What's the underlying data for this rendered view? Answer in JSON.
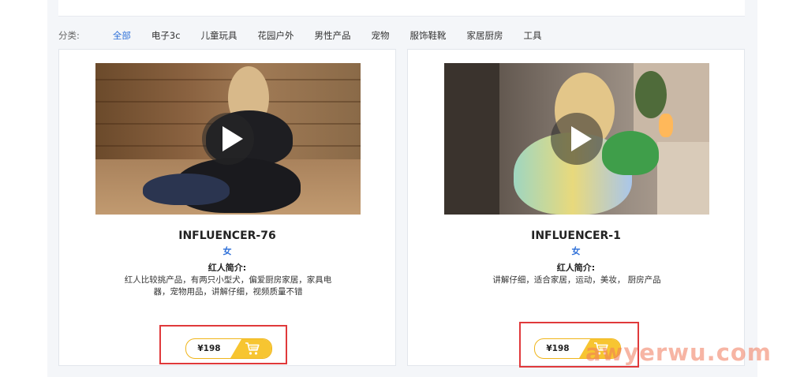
{
  "categories": {
    "label": "分类:",
    "items": [
      "全部",
      "电子3c",
      "儿童玩具",
      "花园户外",
      "男性产品",
      "宠物",
      "服饰鞋靴",
      "家居厨房",
      "工具"
    ],
    "active_index": 0,
    "active_color": "#2d6fd8"
  },
  "cards": [
    {
      "name": "INFLUENCER-76",
      "gender": "女",
      "intro_title": "红人简介:",
      "intro": "红人比较挑产品，有两只小型犬，偏爱厨房家居，家具电器，宠物用品，讲解仔细，视频质量不错",
      "price": "¥198",
      "thumbnail_icon": "play-icon"
    },
    {
      "name": "INFLUENCER-1",
      "gender": "女",
      "intro_title": "红人简介:",
      "intro": "讲解仔细，适合家居，运动，美妆， 厨房产品",
      "price": "¥198",
      "thumbnail_icon": "play-icon"
    }
  ],
  "watermark": "awyerwu.com",
  "colors": {
    "accent": "#2d6fd8",
    "cart": "#f7c531",
    "highlight_box": "#e0393b"
  }
}
